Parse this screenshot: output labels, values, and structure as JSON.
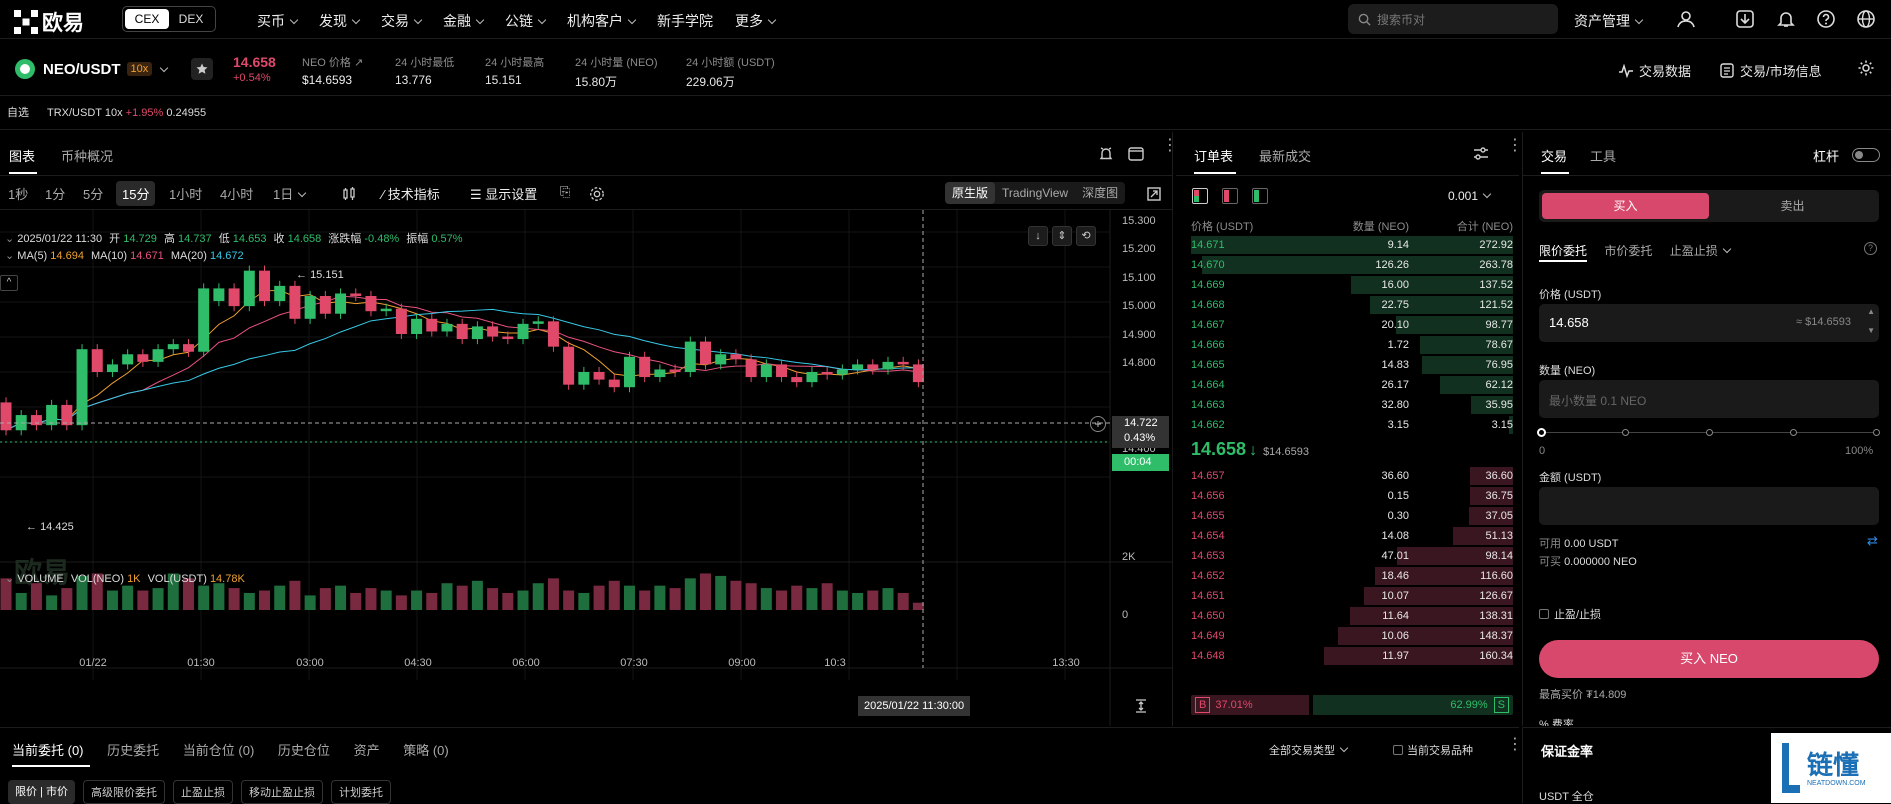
{
  "nav": {
    "logo": "欧易",
    "cex": "CEX",
    "dex": "DEX",
    "items": [
      "买币",
      "发现",
      "交易",
      "金融",
      "公链",
      "机构客户",
      "新手学院",
      "更多"
    ],
    "search_placeholder": "搜索币对",
    "assets": "资产管理"
  },
  "ticker": {
    "pair": "NEO/USDT",
    "leverage": "10x",
    "price": "14.658",
    "change": "+0.54%",
    "index_label": "NEO 价格",
    "index_value": "$14.6593",
    "stats": [
      {
        "label": "24 小时最低",
        "value": "13.776"
      },
      {
        "label": "24 小时最高",
        "value": "15.151"
      },
      {
        "label": "24 小时量 (NEO)",
        "value": "15.80万"
      },
      {
        "label": "24 小时额 (USDT)",
        "value": "229.06万"
      }
    ],
    "trade_data": "交易数据",
    "market_info": "交易/市场信息"
  },
  "watch": {
    "label": "自选",
    "pair": "TRX/USDT 10x",
    "change": "+1.95%",
    "price": "0.24955"
  },
  "chart_tabs": {
    "chart": "图表",
    "overview": "币种概况"
  },
  "intervals": [
    "1秒",
    "1分",
    "5分",
    "15分",
    "1小时",
    "4小时",
    "1日"
  ],
  "toolbar": {
    "indicators": "技术指标",
    "display": "显示设置",
    "views": [
      "原生版",
      "TradingView",
      "深度图"
    ]
  },
  "ohlc": {
    "date": "2025/01/22 11:30",
    "open_l": "开",
    "open": "14.729",
    "high_l": "高",
    "high": "14.737",
    "low_l": "低",
    "low": "14.653",
    "close_l": "收",
    "close": "14.658",
    "chg_l": "涨跌幅",
    "chg": "-0.48%",
    "amp_l": "振幅",
    "amp": "0.57%"
  },
  "ma": {
    "ma5_l": "MA(5)",
    "ma5": "14.694",
    "ma10_l": "MA(10)",
    "ma10": "14.671",
    "ma20_l": "MA(20)",
    "ma20": "14.672"
  },
  "vol": {
    "label": "VOLUME",
    "neo_l": "VOL(NEO)",
    "neo": "1K",
    "usdt_l": "VOL(USDT)",
    "usdt": "14.78K"
  },
  "chart_data": {
    "type": "candlestick",
    "y_ticks": [
      "15.300",
      "15.200",
      "15.100",
      "15.000",
      "14.900",
      "14.800",
      "14.500",
      "14.400"
    ],
    "ylim": [
      14.4,
      15.3
    ],
    "x_ticks": [
      "01/22",
      "01:30",
      "03:00",
      "04:30",
      "06:00",
      "07:30",
      "09:00",
      "10:3"
    ],
    "crosshair_time": "2025/01/22 11:30:00",
    "last_time": "13:30",
    "price_tag": "14.722",
    "pct_tag": "0.43%",
    "countdown": "00:04",
    "high_mark": "15.151",
    "low_mark": "14.425",
    "vol_ticks": [
      "2K",
      "0"
    ],
    "candles": [
      [
        14.58,
        14.47
      ],
      [
        14.47,
        14.53
      ],
      [
        14.53,
        14.49
      ],
      [
        14.49,
        14.57
      ],
      [
        14.57,
        14.49
      ],
      [
        14.49,
        14.79
      ],
      [
        14.79,
        14.7
      ],
      [
        14.7,
        14.73
      ],
      [
        14.73,
        14.77
      ],
      [
        14.77,
        14.74
      ],
      [
        14.74,
        14.79
      ],
      [
        14.79,
        14.81
      ],
      [
        14.81,
        14.78
      ],
      [
        14.78,
        15.03
      ],
      [
        14.98,
        15.03
      ],
      [
        15.03,
        14.96
      ],
      [
        14.96,
        15.1
      ],
      [
        15.1,
        14.98
      ],
      [
        14.98,
        15.04
      ],
      [
        15.04,
        14.91
      ],
      [
        14.91,
        15.0
      ],
      [
        15.0,
        14.93
      ],
      [
        14.93,
        15.01
      ],
      [
        15.01,
        15.0
      ],
      [
        15.0,
        14.94
      ],
      [
        14.94,
        14.95
      ],
      [
        14.95,
        14.85
      ],
      [
        14.85,
        14.91
      ],
      [
        14.91,
        14.86
      ],
      [
        14.86,
        14.89
      ],
      [
        14.89,
        14.83
      ],
      [
        14.83,
        14.88
      ],
      [
        14.88,
        14.84
      ],
      [
        14.84,
        14.83
      ],
      [
        14.83,
        14.89
      ],
      [
        14.89,
        14.9
      ],
      [
        14.9,
        14.8
      ],
      [
        14.8,
        14.65
      ],
      [
        14.65,
        14.7
      ],
      [
        14.7,
        14.67
      ],
      [
        14.67,
        14.64
      ],
      [
        14.64,
        14.76
      ],
      [
        14.76,
        14.68
      ],
      [
        14.68,
        14.71
      ],
      [
        14.71,
        14.7
      ],
      [
        14.7,
        14.82
      ],
      [
        14.82,
        14.73
      ],
      [
        14.73,
        14.77
      ],
      [
        14.77,
        14.75
      ],
      [
        14.75,
        14.68
      ],
      [
        14.68,
        14.73
      ],
      [
        14.73,
        14.68
      ],
      [
        14.68,
        14.66
      ],
      [
        14.66,
        14.7
      ],
      [
        14.7,
        14.69
      ],
      [
        14.69,
        14.71
      ],
      [
        14.71,
        14.73
      ],
      [
        14.73,
        14.71
      ],
      [
        14.71,
        14.74
      ],
      [
        14.74,
        14.73
      ],
      [
        14.73,
        14.66
      ]
    ],
    "volumes": [
      1.3,
      0.7,
      1.1,
      0.6,
      0.9,
      1.4,
      1.5,
      0.8,
      1.0,
      0.8,
      0.9,
      1.5,
      1.3,
      1.0,
      1.1,
      0.9,
      0.7,
      0.8,
      1.0,
      1.2,
      0.6,
      0.9,
      1.0,
      0.7,
      0.9,
      0.8,
      0.6,
      0.8,
      0.7,
      1.1,
      1.0,
      1.2,
      0.9,
      0.7,
      0.8,
      1.1,
      1.3,
      0.8,
      0.7,
      1.0,
      1.2,
      1.0,
      0.8,
      1.0,
      0.9,
      1.3,
      1.5,
      1.4,
      1.2,
      1.1,
      0.9,
      0.8,
      1.0,
      0.9,
      1.1,
      0.8,
      0.7,
      0.8,
      0.9,
      0.7,
      0.3
    ]
  },
  "orderbook": {
    "tab1": "订单表",
    "tab2": "最新成交",
    "precision": "0.001",
    "h_price": "价格 (USDT)",
    "h_qty": "数量 (NEO)",
    "h_total": "合计 (NEO)",
    "asks": [
      [
        "14.671",
        "9.14",
        "272.92"
      ],
      [
        "14.670",
        "126.26",
        "263.78"
      ],
      [
        "14.669",
        "16.00",
        "137.52"
      ],
      [
        "14.668",
        "22.75",
        "121.52"
      ],
      [
        "14.667",
        "20.10",
        "98.77"
      ],
      [
        "14.666",
        "1.72",
        "78.67"
      ],
      [
        "14.665",
        "14.83",
        "76.95"
      ],
      [
        "14.664",
        "26.17",
        "62.12"
      ],
      [
        "14.663",
        "32.80",
        "35.95"
      ],
      [
        "14.662",
        "3.15",
        "3.15"
      ]
    ],
    "mid": "14.658",
    "mid_usd": "$14.6593",
    "bids": [
      [
        "14.657",
        "36.60",
        "36.60"
      ],
      [
        "14.656",
        "0.15",
        "36.75"
      ],
      [
        "14.655",
        "0.30",
        "37.05"
      ],
      [
        "14.654",
        "14.08",
        "51.13"
      ],
      [
        "14.653",
        "47.01",
        "98.14"
      ],
      [
        "14.652",
        "18.46",
        "116.60"
      ],
      [
        "14.651",
        "10.07",
        "126.67"
      ],
      [
        "14.650",
        "11.64",
        "138.31"
      ],
      [
        "14.649",
        "10.06",
        "148.37"
      ],
      [
        "14.648",
        "11.97",
        "160.34"
      ]
    ],
    "buy_pct": "37.01%",
    "sell_pct": "62.99%",
    "b": "B",
    "s": "S"
  },
  "trade": {
    "tab1": "交易",
    "tab2": "工具",
    "leverage": "杠杆",
    "buy": "买入",
    "sell": "卖出",
    "types": [
      "限价委托",
      "市价委托",
      "止盈止损"
    ],
    "price_label": "价格 (USDT)",
    "price": "14.658",
    "price_usd": "≈ $14.6593",
    "qty_label": "数量 (NEO)",
    "qty_placeholder": "最小数量 0.1 NEO",
    "slider_min": "0",
    "slider_max": "100%",
    "amount_label": "金额 (USDT)",
    "avail_l": "可用",
    "avail": "0.00 USDT",
    "canbuy_l": "可买",
    "canbuy": "0.000000 NEO",
    "tpsl": "止盈/止损",
    "submit": "买入 NEO",
    "max_buy": "最高买价 ₮14.809",
    "fee": "% 费率"
  },
  "bottom": {
    "tabs": [
      "当前委托 (0)",
      "历史委托",
      "当前仓位 (0)",
      "历史仓位",
      "资产",
      "策略 (0)"
    ],
    "filter": "全部交易类型",
    "current_pair": "当前交易品种",
    "subtabs": [
      "限价 | 市价",
      "高级限价委托",
      "止盈止损",
      "移动止盈止损",
      "计划委托"
    ]
  },
  "margin": {
    "title": "保证金率",
    "currency": "USDT 全仓"
  },
  "watermark": {
    "cn": "链懂",
    "en": "NEATDOWN.COM"
  }
}
